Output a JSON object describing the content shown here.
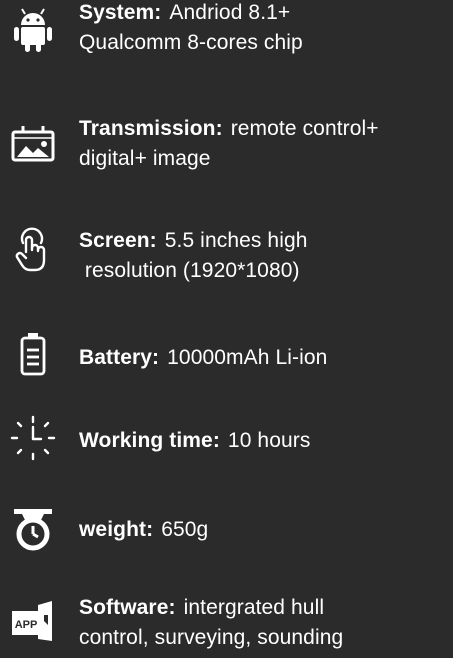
{
  "specs": [
    {
      "icon": "android-icon",
      "label": "System:",
      "value_line1": "Andriod 8.1+",
      "value_line2": "Qualcomm 8-cores chip"
    },
    {
      "icon": "monitor-image-icon",
      "label": "Transmission:",
      "value_line1": "remote control+",
      "value_line2": "digital+ image"
    },
    {
      "icon": "touch-hand-icon",
      "label": "Screen:",
      "value_line1": "5.5 inches high",
      "value_line2": " resolution (1920*1080)"
    },
    {
      "icon": "battery-icon",
      "label": "Battery:",
      "value_line1": "10000mAh Li-ion",
      "value_line2": ""
    },
    {
      "icon": "timer-icon",
      "label": "Working time:",
      "value_line1": "10 hours",
      "value_line2": ""
    },
    {
      "icon": "scale-icon",
      "label": "weight:",
      "value_line1": "650g",
      "value_line2": ""
    },
    {
      "icon": "app-icon",
      "icon_text": "APP",
      "label": "Software:",
      "value_line1": "intergrated hull",
      "value_line2": "control, surveying, sounding"
    }
  ]
}
